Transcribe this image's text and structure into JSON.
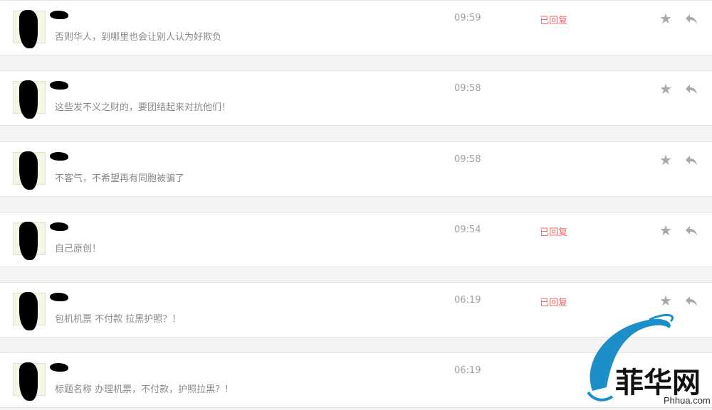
{
  "messages": [
    {
      "text": "否则华人，到哪里也会让别人认为好欺负",
      "time": "09:59",
      "status": "已回复"
    },
    {
      "text": "这些发不义之财的，要团结起来对抗他们！",
      "time": "09:58",
      "status": ""
    },
    {
      "text": "不客气，不希望再有同胞被骗了",
      "time": "09:58",
      "status": ""
    },
    {
      "text": "自己原创！",
      "time": "09:54",
      "status": "已回复"
    },
    {
      "text": "包机机票 不付款 拉黑护照？！",
      "time": "06:19",
      "status": "已回复"
    },
    {
      "text": "标题名称 办理机票，不付款，护照拉黑？！",
      "time": "06:19",
      "status": ""
    }
  ],
  "icons": {
    "star": "star-icon",
    "reply": "reply-arrow-icon"
  },
  "colors": {
    "status": "#f0676b",
    "icon": "#a9a9a9",
    "logo_blue": "#1d8fc8"
  },
  "watermark": {
    "logo_text": "菲华网",
    "url": "Phhua.com"
  }
}
